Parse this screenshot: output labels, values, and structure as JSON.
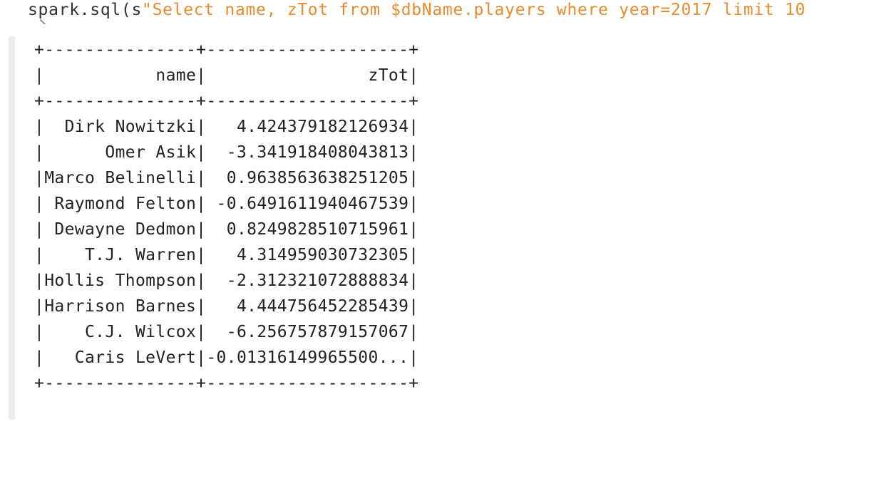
{
  "cell": {
    "code_prefix": "spark.sql(s",
    "code_string": "\"Select name, zTot from $dbName.players where year=2017 limit 10"
  },
  "output": {
    "lines": [
      "+---------------+--------------------+",
      "|           name|                zTot|",
      "+---------------+--------------------+",
      "|  Dirk Nowitzki|   4.424379182126934|",
      "|      Omer Asik|  -3.341918408043813|",
      "|Marco Belinelli|  0.9638563638251205|",
      "| Raymond Felton| -0.6491611940467539|",
      "| Dewayne Dedmon|  0.8249828510715961|",
      "|    T.J. Warren|   4.314959030732305|",
      "|Hollis Thompson|  -2.312321072888834|",
      "|Harrison Barnes|   4.444756452285439|",
      "|    C.J. Wilcox|  -6.256757879157067|",
      "|   Caris LeVert|-0.01316149965500...|",
      "+---------------+--------------------+"
    ]
  },
  "icons": {
    "chevron": "chevron-right-icon"
  },
  "colors": {
    "code_text": "#333333",
    "string_literal": "#e88b2e",
    "output_text": "#222222",
    "output_bar": "#ececec"
  }
}
